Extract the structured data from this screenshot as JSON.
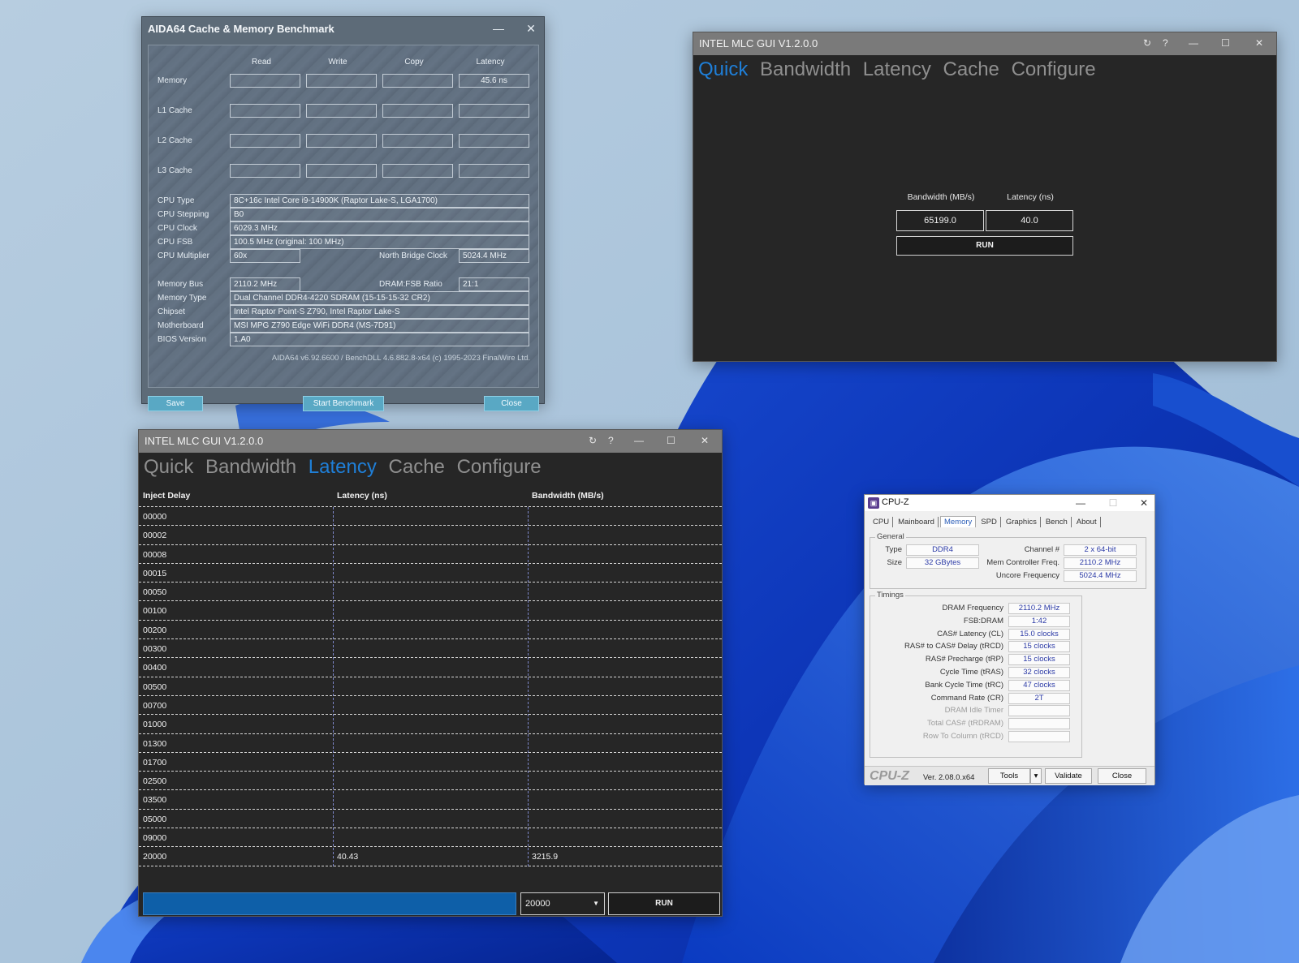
{
  "aida": {
    "title": "AIDA64 Cache & Memory Benchmark",
    "columns": [
      "Read",
      "Write",
      "Copy",
      "Latency"
    ],
    "rows": [
      {
        "label": "Memory",
        "values": [
          "",
          "",
          "",
          "45.6 ns"
        ]
      },
      {
        "label": "L1 Cache",
        "values": [
          "",
          "",
          "",
          ""
        ]
      },
      {
        "label": "L2 Cache",
        "values": [
          "",
          "",
          "",
          ""
        ]
      },
      {
        "label": "L3 Cache",
        "values": [
          "",
          "",
          "",
          ""
        ]
      }
    ],
    "info": {
      "cpu_type_label": "CPU Type",
      "cpu_type": "8C+16c Intel Core i9-14900K  (Raptor Lake-S, LGA1700)",
      "cpu_stepping_label": "CPU Stepping",
      "cpu_stepping": "B0",
      "cpu_clock_label": "CPU Clock",
      "cpu_clock": "6029.3 MHz",
      "cpu_fsb_label": "CPU FSB",
      "cpu_fsb": "100.5 MHz  (original: 100 MHz)",
      "cpu_mult_label": "CPU Multiplier",
      "cpu_mult": "60x",
      "nb_clock_label": "North Bridge Clock",
      "nb_clock": "5024.4 MHz",
      "mem_bus_label": "Memory Bus",
      "mem_bus": "2110.2 MHz",
      "dram_ratio_label": "DRAM:FSB Ratio",
      "dram_ratio": "21:1",
      "mem_type_label": "Memory Type",
      "mem_type": "Dual Channel DDR4-4220 SDRAM  (15-15-15-32 CR2)",
      "chipset_label": "Chipset",
      "chipset": "Intel Raptor Point-S Z790, Intel Raptor Lake-S",
      "mobo_label": "Motherboard",
      "mobo": "MSI MPG Z790 Edge WiFi DDR4 (MS-7D91)",
      "bios_label": "BIOS Version",
      "bios": "1.A0"
    },
    "footer": "AIDA64 v6.92.6600 / BenchDLL 4.6.882.8-x64  (c) 1995-2023 FinalWire Ltd.",
    "buttons": {
      "save": "Save",
      "start": "Start Benchmark",
      "close": "Close"
    }
  },
  "mlc_quick": {
    "title": "INTEL MLC GUI V1.2.0.0",
    "title_controls": {
      "refresh": "↻",
      "help": "?"
    },
    "nav": [
      "Quick",
      "Bandwidth",
      "Latency",
      "Cache",
      "Configure"
    ],
    "active_tab": "Quick",
    "bandwidth_label": "Bandwidth (MB/s)",
    "latency_label": "Latency (ns)",
    "bandwidth_value": "65199.0",
    "latency_value": "40.0",
    "run": "RUN"
  },
  "mlc_latency": {
    "title": "INTEL MLC GUI V1.2.0.0",
    "title_controls": {
      "refresh": "↻",
      "help": "?"
    },
    "nav": [
      "Quick",
      "Bandwidth",
      "Latency",
      "Cache",
      "Configure"
    ],
    "active_tab": "Latency",
    "headers": [
      "Inject Delay",
      "Latency (ns)",
      "Bandwidth (MB/s)"
    ],
    "rows": [
      [
        "00000",
        "",
        ""
      ],
      [
        "00002",
        "",
        ""
      ],
      [
        "00008",
        "",
        ""
      ],
      [
        "00015",
        "",
        ""
      ],
      [
        "00050",
        "",
        ""
      ],
      [
        "00100",
        "",
        ""
      ],
      [
        "00200",
        "",
        ""
      ],
      [
        "00300",
        "",
        ""
      ],
      [
        "00400",
        "",
        ""
      ],
      [
        "00500",
        "",
        ""
      ],
      [
        "00700",
        "",
        ""
      ],
      [
        "01000",
        "",
        ""
      ],
      [
        "01300",
        "",
        ""
      ],
      [
        "01700",
        "",
        ""
      ],
      [
        "02500",
        "",
        ""
      ],
      [
        "03500",
        "",
        ""
      ],
      [
        "05000",
        "",
        ""
      ],
      [
        "09000",
        "",
        ""
      ],
      [
        "20000",
        "40.43",
        "3215.9"
      ]
    ],
    "progress": 1.0,
    "delay_select": "20000",
    "run": "RUN"
  },
  "cpuz": {
    "title": "CPU-Z",
    "tabs": [
      "CPU",
      "Mainboard",
      "Memory",
      "SPD",
      "Graphics",
      "Bench",
      "About"
    ],
    "active_tab": "Memory",
    "general_label": "General",
    "type_label": "Type",
    "type": "DDR4",
    "size_label": "Size",
    "size": "32 GBytes",
    "channel_label": "Channel #",
    "channel": "2 x 64-bit",
    "mcf_label": "Mem Controller Freq.",
    "mcf": "2110.2 MHz",
    "uncore_label": "Uncore Frequency",
    "uncore": "5024.4 MHz",
    "timings_label": "Timings",
    "timings": [
      {
        "label": "DRAM Frequency",
        "value": "2110.2 MHz",
        "dim": false
      },
      {
        "label": "FSB:DRAM",
        "value": "1:42",
        "dim": false
      },
      {
        "label": "CAS# Latency (CL)",
        "value": "15.0 clocks",
        "dim": false
      },
      {
        "label": "RAS# to CAS# Delay (tRCD)",
        "value": "15 clocks",
        "dim": false
      },
      {
        "label": "RAS# Precharge (tRP)",
        "value": "15 clocks",
        "dim": false
      },
      {
        "label": "Cycle Time (tRAS)",
        "value": "32 clocks",
        "dim": false
      },
      {
        "label": "Bank Cycle Time (tRC)",
        "value": "47 clocks",
        "dim": false
      },
      {
        "label": "Command Rate (CR)",
        "value": "2T",
        "dim": false
      },
      {
        "label": "DRAM Idle Timer",
        "value": "",
        "dim": true
      },
      {
        "label": "Total CAS# (tRDRAM)",
        "value": "",
        "dim": true
      },
      {
        "label": "Row To Column (tRCD)",
        "value": "",
        "dim": true
      }
    ],
    "brand": "CPU-Z",
    "version": "Ver. 2.08.0.x64",
    "buttons": {
      "tools": "Tools",
      "validate": "Validate",
      "close": "Close"
    }
  },
  "colors": {
    "mlc_accent": "#1f7fd8",
    "cpuz_value": "#2b3aa6",
    "aida_button": "#59a8c4"
  },
  "icons": [
    "minimize-icon",
    "maximize-icon",
    "close-icon",
    "refresh-icon",
    "help-icon",
    "dropdown-caret-icon",
    "cpuz-app-icon"
  ]
}
